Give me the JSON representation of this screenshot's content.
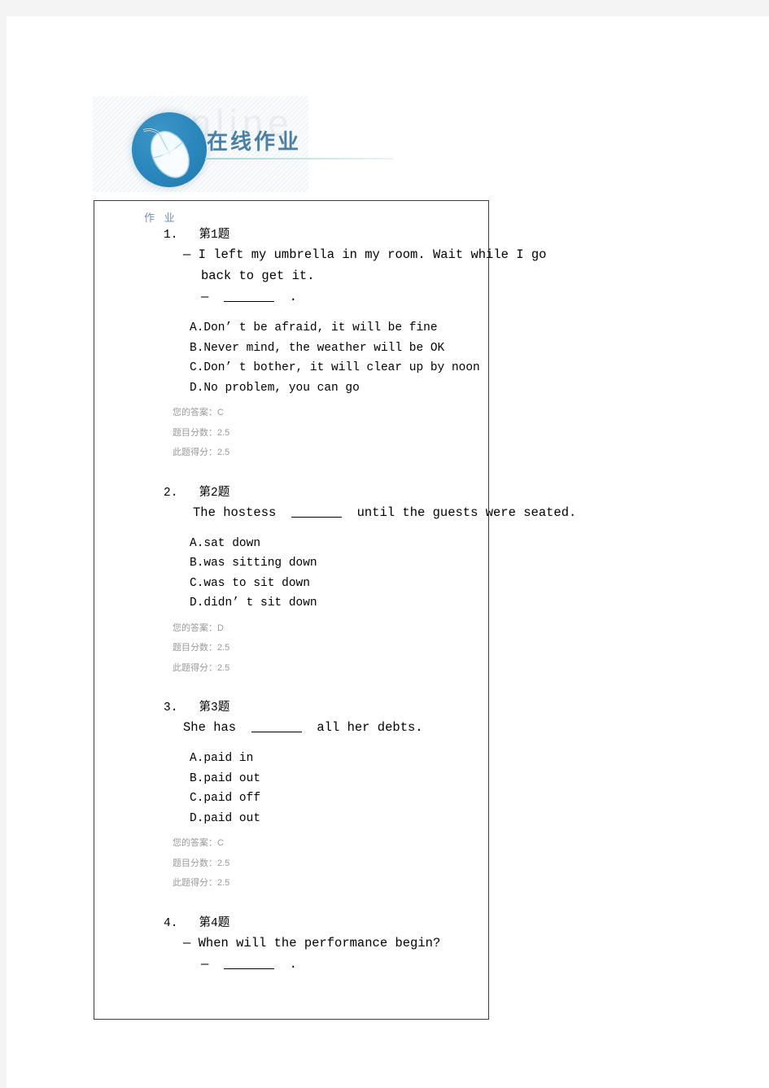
{
  "banner": {
    "title": "在线作业",
    "ghost_text": "online",
    "icon": "computer-mouse-icon"
  },
  "box": {
    "header_label": "作 业"
  },
  "labels": {
    "your_answer": "您的答案：",
    "question_score": "题目分数：",
    "earned_score": "此题得分："
  },
  "questions": [
    {
      "number": "1.",
      "title": "第1题",
      "stem_lines": [
        "—  I left my umbrella in my room. Wait while I go",
        "back to get it."
      ],
      "stem_answer_prefix": "—",
      "stem_answer_suffix": ".",
      "options": [
        "A.Don’ t be afraid, it will be fine",
        "B.Never mind, the weather will be OK",
        "C.Don’ t bother, it will clear up by noon",
        "D.No problem, you can go"
      ],
      "your_answer": "C",
      "question_score": "2.5",
      "earned_score": "2.5"
    },
    {
      "number": "2.",
      "title": "第2题",
      "stem_prefix": "The hostess",
      "stem_suffix": "until the guests were seated.",
      "options": [
        "A.sat down",
        "B.was sitting down",
        "C.was to sit down",
        "D.didn’ t sit down"
      ],
      "your_answer": "D",
      "question_score": "2.5",
      "earned_score": "2.5"
    },
    {
      "number": "3.",
      "title": "第3题",
      "stem_prefix": "She has",
      "stem_suffix": "all her debts.",
      "options": [
        "A.paid in",
        "B.paid out",
        "C.paid off",
        "D.paid out"
      ],
      "your_answer": "C",
      "question_score": "2.5",
      "earned_score": "2.5"
    },
    {
      "number": "4.",
      "title": "第4题",
      "stem_lines": [
        "—  When will the performance begin?"
      ],
      "stem_answer_prefix": "—",
      "stem_answer_suffix": "."
    }
  ]
}
